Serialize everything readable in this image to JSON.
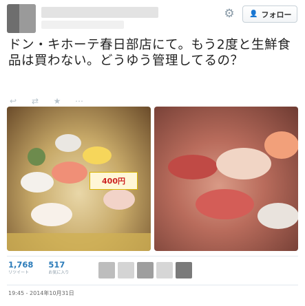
{
  "header": {
    "gear_glyph": "⚙",
    "follow_icon": "person-plus-icon",
    "follow_glyph": "👤",
    "follow_label": "フォロー"
  },
  "tweet": {
    "text": "ドン・キホーテ春日部店にて。もう2度と生鮮食品は買わない。どうゆう管理してるの？",
    "actions": [
      {
        "name": "reply-icon",
        "glyph": "↩"
      },
      {
        "name": "retweet-icon",
        "glyph": "⇄"
      },
      {
        "name": "favorite-icon",
        "glyph": "★"
      },
      {
        "name": "more-icon",
        "glyph": "⋯"
      }
    ],
    "images": [
      {
        "name": "sushi-tray-photo",
        "price_label": "400円"
      },
      {
        "name": "sushi-closeup-photo"
      }
    ]
  },
  "stats": {
    "retweets": {
      "value": "1,768",
      "label": "リツイート"
    },
    "favorites": {
      "value": "517",
      "label": "お気に入り"
    }
  },
  "favoriters": [
    {
      "color": "#bdbdbd"
    },
    {
      "color": "#d4d4d4"
    },
    {
      "color": "#9e9e9e"
    },
    {
      "color": "#d6d6d6"
    },
    {
      "color": "#7a7a7a"
    }
  ],
  "timestamp": "19:45 - 2014年10月31日"
}
